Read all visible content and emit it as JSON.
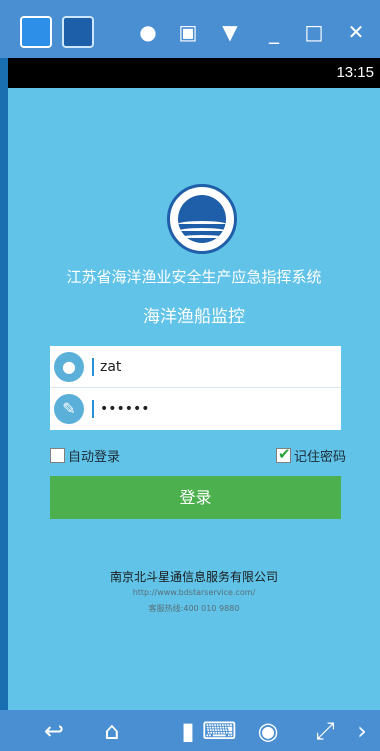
{
  "status_bar": {
    "time": "13:15"
  },
  "app": {
    "org_name": "江苏省海洋渔业安全生产应急指挥系统",
    "system_name": "海洋渔船监控",
    "username": {
      "value": "zat",
      "icon": "user-icon"
    },
    "password": {
      "value": "••••••",
      "icon": "key-icon"
    },
    "auto_login": {
      "label": "自动登录",
      "checked": false
    },
    "remember_password": {
      "label": "记住密码",
      "checked": true
    },
    "login_button": "登录",
    "company": "南京北斗星通信息服务有限公司",
    "url": "http://www.bdstarservice.com/",
    "hotline": "客服热线:400 010 9880"
  },
  "colors": {
    "screen_bg": "#60c3e7",
    "button_green": "#4db04f",
    "emulator_bar": "#4a8fd2"
  }
}
